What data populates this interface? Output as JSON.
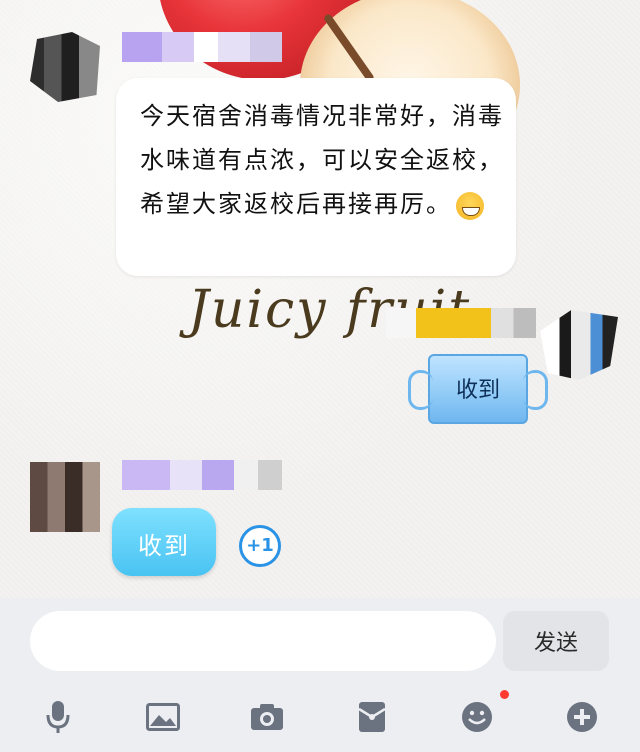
{
  "chat": {
    "wallpaper_text": "Juicy fruit",
    "messages": [
      {
        "id": "m1",
        "text": "今天宿舍消毒情况非常好，消毒水味道有点浓，可以安全返校，希望大家返校后再接再厉。"
      }
    ],
    "sticker_sent": {
      "label": "收到"
    },
    "reply": {
      "label": "收到",
      "plus_one": "+1"
    }
  },
  "input_bar": {
    "input_value": "",
    "send_label": "发送"
  },
  "toolbar": {
    "icons": [
      "microphone-icon",
      "image-icon",
      "camera-icon",
      "red-packet-icon",
      "emoji-icon",
      "plus-icon"
    ],
    "emoji_has_notification": true
  },
  "colors": {
    "accent": "#2a93e5",
    "reply_bubble": "#49c3f2",
    "notification_dot": "#ff3b30"
  }
}
